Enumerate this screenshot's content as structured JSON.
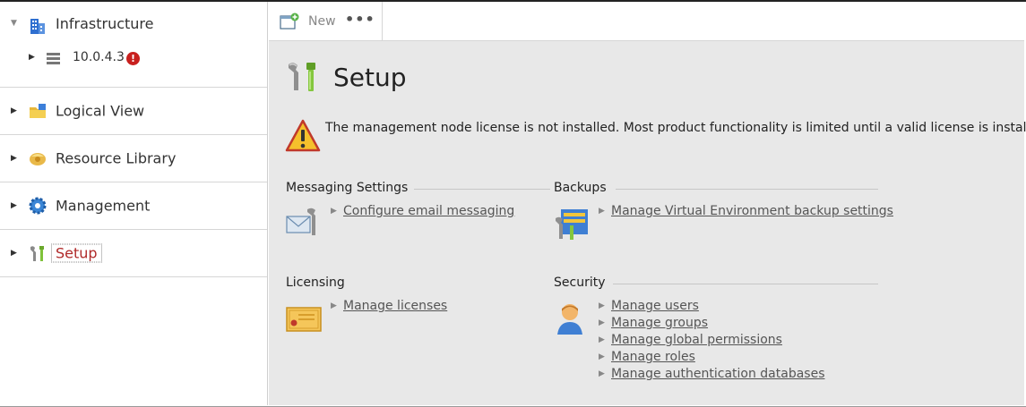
{
  "sidebar": {
    "infrastructure": {
      "label": "Infrastructure",
      "child": {
        "label": "10.0.4.3",
        "error_badge": "!"
      }
    },
    "items": [
      {
        "label": "Logical View"
      },
      {
        "label": "Resource Library"
      },
      {
        "label": "Management"
      },
      {
        "label": "Setup"
      }
    ]
  },
  "toolbar": {
    "new_label": "New",
    "more_label": "•••"
  },
  "page": {
    "title": "Setup",
    "warning": "The management node license is not installed. Most product functionality is limited until a valid license is installed."
  },
  "sections": {
    "messaging": {
      "title": "Messaging Settings",
      "links": [
        "Configure email messaging"
      ]
    },
    "backups": {
      "title": "Backups",
      "links": [
        "Manage Virtual Environment backup settings"
      ]
    },
    "licensing": {
      "title": "Licensing",
      "links": [
        "Manage licenses"
      ]
    },
    "security": {
      "title": "Security",
      "links": [
        "Manage users",
        "Manage groups",
        "Manage global permissions",
        "Manage roles",
        "Manage authentication databases"
      ]
    }
  },
  "colors": {
    "active_label": "#b02a2a",
    "error": "#c8201e",
    "main_bg": "#e8e8e8"
  },
  "icons": {
    "infrastructure": "building-icon",
    "server": "server-icon",
    "logical_view": "folder-icon",
    "resource_library": "library-icon",
    "management": "gear-icon",
    "setup": "wrench-icon"
  }
}
